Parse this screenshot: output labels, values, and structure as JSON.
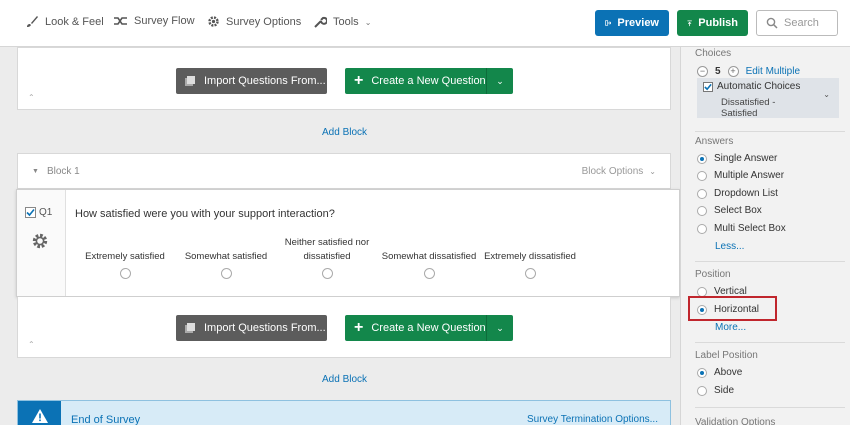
{
  "toolbar": {
    "look_feel": "Look & Feel",
    "survey_flow": "Survey Flow",
    "survey_options": "Survey Options",
    "tools": "Tools",
    "preview": "Preview",
    "publish": "Publish",
    "search_placeholder": "Search"
  },
  "canvas": {
    "import_label": "Import Questions From...",
    "create_label": "Create a New Question",
    "add_block_label": "Add Block",
    "block": {
      "title": "Block 1",
      "options_label": "Block Options"
    },
    "question": {
      "id": "Q1",
      "text": "How satisfied were you with your support interaction?",
      "choices": [
        "Extremely satisfied",
        "Somewhat satisfied",
        "Neither satisfied nor dissatisfied",
        "Somewhat dissatisfied",
        "Extremely dissatisfied"
      ]
    },
    "end_of_survey": {
      "title": "End of Survey",
      "link": "Survey Termination Options..."
    }
  },
  "panel": {
    "choices": {
      "heading": "Choices",
      "count": "5",
      "edit_multiple": "Edit Multiple",
      "automatic_choices": "Automatic Choices",
      "auto_value": "Dissatisfied - Satisfied"
    },
    "answers": {
      "heading": "Answers",
      "options": [
        "Single Answer",
        "Multiple Answer",
        "Dropdown List",
        "Select Box",
        "Multi Select Box"
      ],
      "selected": "Single Answer",
      "less_link": "Less..."
    },
    "position": {
      "heading": "Position",
      "options": [
        "Vertical",
        "Horizontal"
      ],
      "selected": "Horizontal",
      "more_link": "More..."
    },
    "label_position": {
      "heading": "Label Position",
      "options": [
        "Above",
        "Side"
      ],
      "selected": "Above"
    },
    "validation": {
      "heading": "Validation Options"
    }
  },
  "colors": {
    "accent_blue": "#0b72b5",
    "publish_green": "#13874b",
    "highlight_red": "#c0262d"
  }
}
